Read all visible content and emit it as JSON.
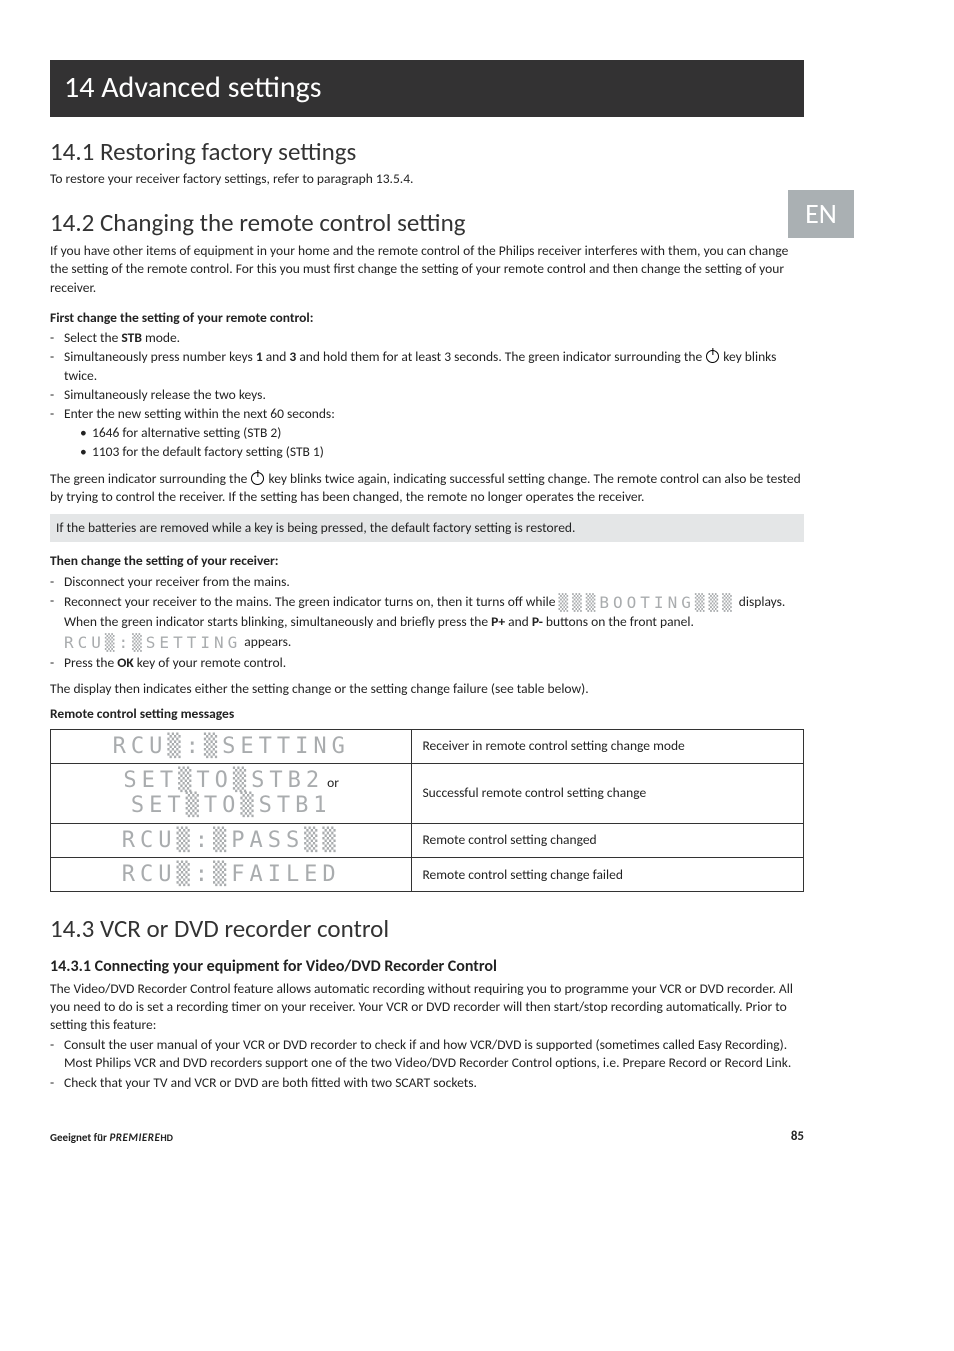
{
  "lang_tab": "EN",
  "title_bar": "14 Advanced settings",
  "s1": {
    "heading": "14.1 Restoring factory settings",
    "text": "To restore your receiver factory settings, refer to paragraph 13.5.4."
  },
  "s2": {
    "heading": "14.2 Changing the remote control setting",
    "intro": "If you have other items of equipment in your home and the remote control of the Philips receiver interferes with them, you can change the setting of the remote control. For this you must first change the setting of your remote control and then change the setting of your receiver.",
    "first_label": "First change the setting of your remote control:",
    "li1a": "Select the ",
    "li1b": "STB",
    "li1c": " mode.",
    "li2a": "Simultaneously press number keys ",
    "li2b": "1",
    "li2c": " and ",
    "li2d": "3",
    "li2e": " and hold them for at least 3 seconds. The green indicator surrounding the ",
    "li2f": " key blinks twice.",
    "li3": "Simultaneously release the two keys.",
    "li4": "Enter the new setting within the next 60 seconds:",
    "li4a": "1646 for alternative setting (STB 2)",
    "li4b": "1103 for the default factory setting (STB 1)",
    "after1a": "The green indicator surrounding the ",
    "after1b": " key blinks twice again, indicating successful setting change. The remote control can also be tested by trying to control the receiver. If the setting has been changed, the remote no longer operates the receiver.",
    "note": " If the batteries are removed while a key is being pressed, the default factory setting is restored.",
    "then_label": "Then change the setting of your receiver:",
    "t1": "Disconnect your receiver from the mains.",
    "t2a": "Reconnect your receiver to the mains. The green indicator turns on, then it turns off while ",
    "t2seg1": "▒▒▒BOOTING▒▒▒",
    "t2b": " displays. When the green indicator starts blinking, simultaneously and briefly press the ",
    "t2p1": "P+",
    "t2c": " and ",
    "t2p2": "P-",
    "t2d": " buttons on the front panel. ",
    "t2seg2": "RCU▒:▒SETTING",
    "t2e": " appears.",
    "t3a": "Press the ",
    "t3b": "OK",
    "t3c": " key of your remote control.",
    "after2": "The display then indicates either the setting change or the setting change failure (see table below).",
    "table_label": "Remote control setting messages",
    "rows": [
      {
        "disp": "RCU▒:▒SETTING",
        "desc": "Receiver in remote control setting change mode"
      },
      {
        "disp": "SET▒TO▒STB2",
        "disp2": "SET▒TO▒STB1",
        "join": " or",
        "desc": "Successful remote control setting change"
      },
      {
        "disp": "RCU▒:▒PASS▒▒",
        "desc": "Remote control setting changed"
      },
      {
        "disp": "RCU▒:▒FAILED",
        "desc": "Remote control setting change failed"
      }
    ]
  },
  "s3": {
    "heading": "14.3 VCR or DVD recorder control",
    "sub": "14.3.1 Connecting your equipment for Video/DVD Recorder Control",
    "p1": "The Video/DVD Recorder Control feature allows automatic recording without requiring you to programme your VCR or DVD recorder. All you need to do is set a recording timer on your receiver. Your VCR or DVD recorder will then start/stop recording automatically. Prior to setting this feature:",
    "li1": "Consult the user manual of your VCR or DVD recorder to check if and how VCR/DVD is supported (sometimes called Easy Recording). Most Philips VCR and DVD recorders support one of the two Video/DVD Recorder Control options, i.e. Prepare Record or Record Link.",
    "li2": "Check that your TV and VCR or DVD are both fitted with two SCART sockets."
  },
  "footer": {
    "left1": "Geeignet für ",
    "left2": "PREMIERE",
    "left3": "HD",
    "page": "85"
  }
}
